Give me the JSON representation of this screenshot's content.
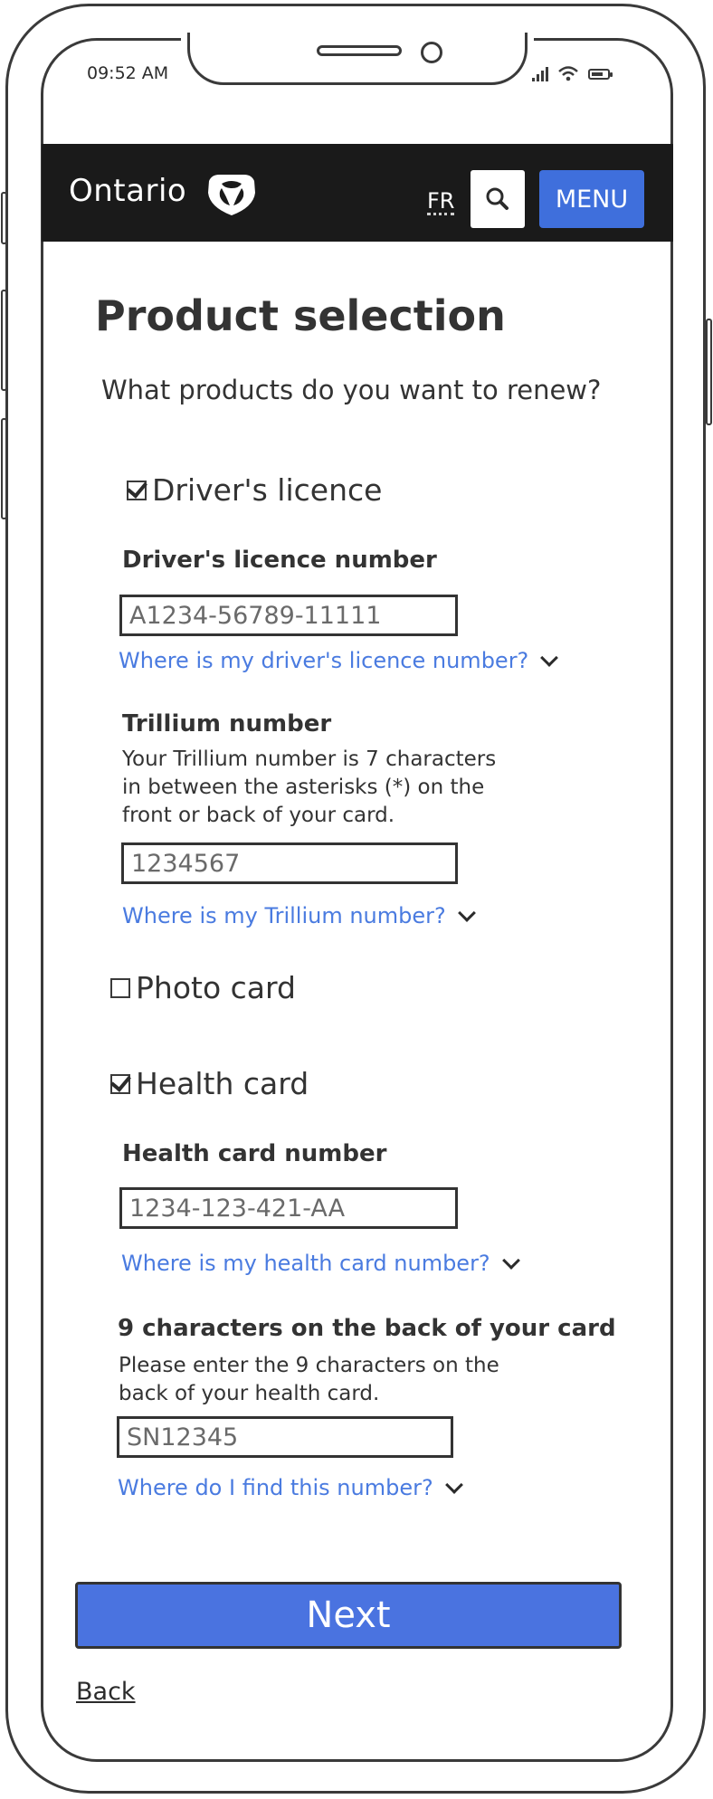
{
  "status_bar": {
    "time": "09:52 AM"
  },
  "header": {
    "logo_text": "Ontario",
    "language_link": "FR",
    "search_icon": "search-icon",
    "menu_label": "MENU",
    "accent_color": "#3f6fdc",
    "background_color": "#1a1a1a"
  },
  "page": {
    "title": "Product selection",
    "question": "What products do you want to renew?"
  },
  "products": {
    "drivers_licence": {
      "label": "Driver's licence",
      "checked": true
    },
    "photo_card": {
      "label": "Photo card",
      "checked": false
    },
    "health_card": {
      "label": "Health card",
      "checked": true
    }
  },
  "drivers_licence_number": {
    "label": "Driver's licence number",
    "value": "A1234-56789-11111",
    "help_link": "Where is my driver's licence number?"
  },
  "trillium_number": {
    "label": "Trillium number",
    "help_line_1": "Your Trillium number is 7 characters",
    "help_line_2": "in between the asterisks (*) on the",
    "help_line_3": "front or back of your card.",
    "value": "1234567",
    "help_link": "Where is my Trillium number?"
  },
  "health_card_number": {
    "label": "Health card number",
    "value": "1234-123-421-AA",
    "help_link": "Where is my health card number?"
  },
  "back_characters": {
    "label": "9 characters on the back of your card",
    "help_line_1": "Please enter the 9 characters on the",
    "help_line_2": "back of your health card.",
    "value": "SN12345",
    "help_link": "Where do I find this number?"
  },
  "actions": {
    "next_label": "Next",
    "back_label": "Back",
    "link_color": "#4a7be0"
  }
}
